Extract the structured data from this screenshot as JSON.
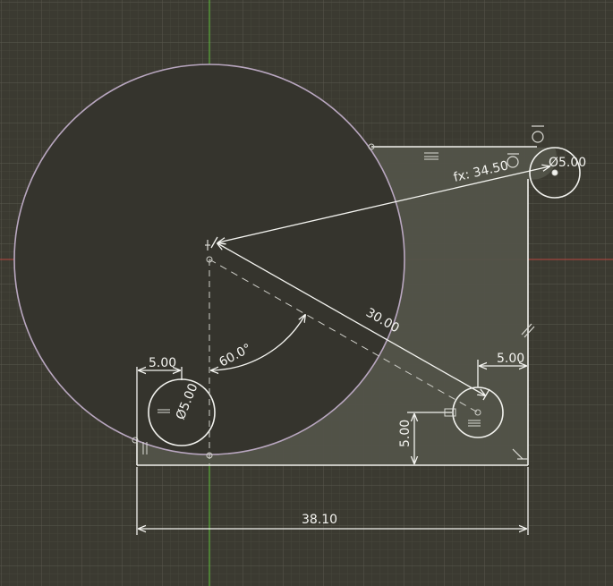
{
  "sketch": {
    "colors": {
      "background": "#3b3a31",
      "grid_minor": "#4a493f",
      "grid_major": "#5a594e",
      "axis_vertical": "#5fc23a",
      "axis_horizontal": "#b8453f",
      "profile_fill": "#525349",
      "large_circle_fill": "#35342d",
      "large_circle_stroke": "#b9a7c0",
      "geometry": "#f2f2ee",
      "dimension": "#f4f4f0",
      "construction": "#cfcfc9"
    },
    "dimensions": {
      "offset_left": "5.00",
      "hole_left_diameter": "Ø5.00",
      "angle": "60.0°",
      "radius_length": "30.00",
      "formula_length": "fx: 34.50",
      "hole_right_top_diameter": "Ø5.00",
      "offset_right": "5.00",
      "offset_vertical": "5.00",
      "total_width": "38.10"
    },
    "constraint_icons": {
      "horizontal": "horizontal-constraint-icon",
      "vertical": "vertical-constraint-icon",
      "tangent": "tangent-constraint-icon",
      "parallel": "parallel-constraint-icon",
      "perpendicular": "perpendicular-constraint-icon",
      "coincident": "coincident-constraint-icon"
    }
  }
}
